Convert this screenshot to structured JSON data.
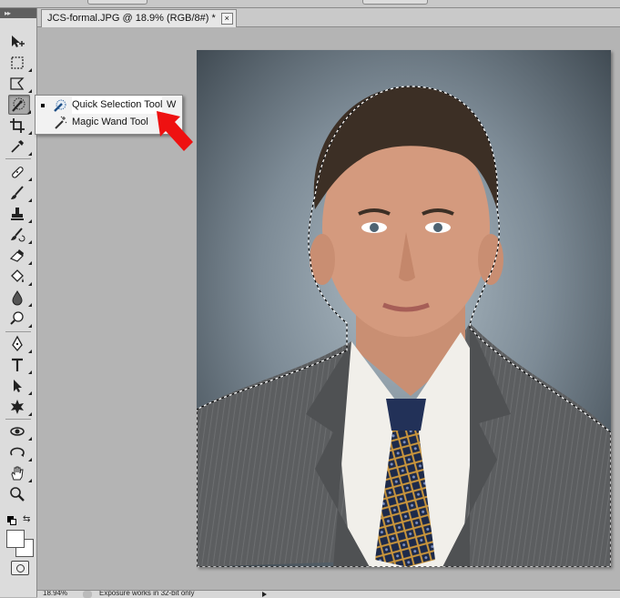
{
  "document": {
    "tab_title": "JCS-formal.JPG @ 18.9% (RGB/8#) *",
    "close_glyph": "×"
  },
  "tool_flyout": {
    "items": [
      {
        "label": "Quick Selection Tool",
        "shortcut": "W",
        "selected": true
      },
      {
        "label": "Magic Wand Tool",
        "shortcut": "",
        "selected": false
      }
    ]
  },
  "tools_panel": {
    "collapse_glyph": "▸▸",
    "tools": [
      "move-icon",
      "marquee-icon",
      "lasso-icon",
      "quick-selection-icon",
      "crop-icon",
      "eyedropper-icon",
      "healing-brush-icon",
      "brush-icon",
      "clone-stamp-icon",
      "history-brush-icon",
      "eraser-icon",
      "paint-bucket-icon",
      "blur-icon",
      "dodge-icon",
      "pen-icon",
      "type-icon",
      "path-selection-icon",
      "shape-icon",
      "3d-rotate-icon",
      "3d-orbit-icon",
      "hand-icon",
      "zoom-icon"
    ],
    "foreground_color": "#ffffff",
    "background_color": "#ffffff"
  },
  "status_bar": {
    "zoom": "18.94%",
    "info": "Exposure works in 32-bit only"
  },
  "colors": {
    "highlight_arrow": "#ee1111",
    "panel_bg": "#dcdcdc",
    "workspace_bg": "#b4b4b4"
  }
}
